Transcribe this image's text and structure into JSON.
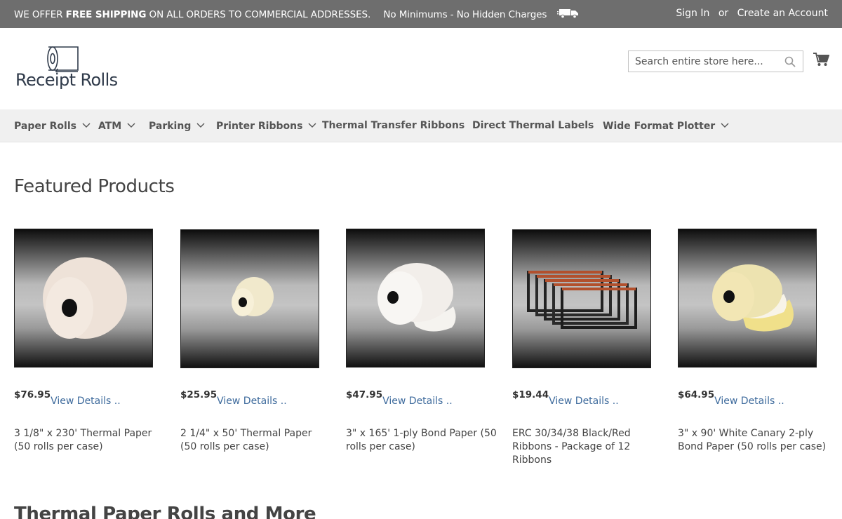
{
  "promo": {
    "prefix": "WE OFFER",
    "bold": "FREE SHIPPING",
    "suffix": "ON ALL ORDERS TO COMMERCIAL ADDRESSES.",
    "secondary": "No Minimums - No Hidden Charges",
    "icon": "truck-icon"
  },
  "account": {
    "sign_in": "Sign In",
    "or": "or",
    "create": "Create an Account"
  },
  "logo": {
    "text": "Receipt Rolls",
    "icon": "paper-roll-icon"
  },
  "search": {
    "placeholder": "Search entire store here...",
    "icon": "search-icon"
  },
  "cart": {
    "icon": "cart-icon"
  },
  "nav": {
    "items": [
      {
        "label": "Paper Rolls",
        "has_dropdown": true
      },
      {
        "label": "ATM",
        "has_dropdown": true
      },
      {
        "label": "Parking",
        "has_dropdown": true
      },
      {
        "label": "Printer Ribbons",
        "has_dropdown": true
      },
      {
        "label": "Thermal Transfer Ribbons",
        "has_dropdown": false
      },
      {
        "label": "Direct Thermal Labels",
        "has_dropdown": false
      },
      {
        "label": "Wide Format Plotter",
        "has_dropdown": true
      }
    ]
  },
  "featured": {
    "title": "Featured Products",
    "view_label": "View Details ..",
    "products": [
      {
        "price": "$76.95",
        "name": "3 1/8\" x 230' Thermal Paper (50 rolls per case)"
      },
      {
        "price": "$25.95",
        "name": "2 1/4\" x 50' Thermal Paper (50 rolls per case)"
      },
      {
        "price": "$47.95",
        "name": "3\" x 165' 1-ply Bond Paper (50 rolls per case)"
      },
      {
        "price": "$19.44",
        "name": "ERC 30/34/38 Black/Red Ribbons - Package of 12 Ribbons"
      },
      {
        "price": "$64.95",
        "name": "3\" x 90' White Canary 2-ply Bond Paper (50 rolls per case)"
      }
    ]
  },
  "next_section": {
    "title": "Thermal Paper Rolls and More"
  },
  "colors": {
    "promo_bg": "#6e6e6e",
    "nav_bg": "#f0f0f0",
    "link": "#3d6a9c"
  }
}
